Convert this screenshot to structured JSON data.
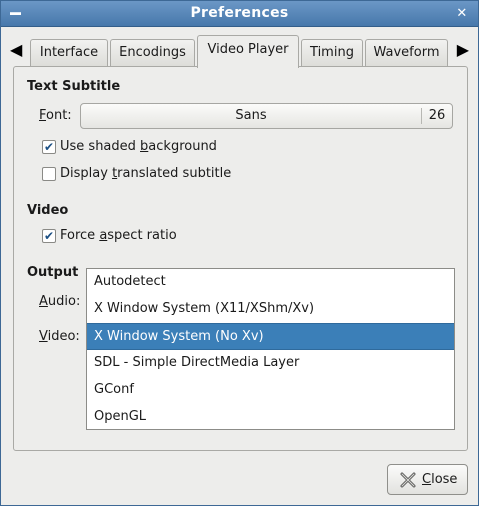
{
  "window": {
    "title": "Preferences"
  },
  "tabs": [
    {
      "label": "Interface"
    },
    {
      "label": "Encodings"
    },
    {
      "label": "Video Player"
    },
    {
      "label": "Timing"
    },
    {
      "label": "Waveform"
    }
  ],
  "active_tab": "Video Player",
  "text_subtitle": {
    "title": "Text Subtitle",
    "font_label_mn": "F",
    "font_label_rest": "ont:",
    "font_name": "Sans",
    "font_size": "26",
    "shaded_bg": {
      "pre": "Use shaded ",
      "mn": "b",
      "post": "ackground",
      "checked": true
    },
    "translated": {
      "pre": "Display ",
      "mn": "t",
      "post": "ranslated subtitle",
      "checked": false
    }
  },
  "video": {
    "title": "Video",
    "force_aspect": {
      "pre": "Force ",
      "mn": "a",
      "post": "spect ratio",
      "checked": true
    }
  },
  "output": {
    "title": "Output",
    "audio_mn": "A",
    "audio_rest": "udio:",
    "video_mn": "V",
    "video_rest": "ideo:",
    "options": [
      {
        "label": "Autodetect"
      },
      {
        "label": "X Window System (X11/XShm/Xv)"
      },
      {
        "label": "X Window System (No Xv)"
      },
      {
        "label": "SDL - Simple DirectMedia Layer"
      },
      {
        "label": "GConf"
      },
      {
        "label": "OpenGL"
      }
    ],
    "selected": "X Window System (No Xv)"
  },
  "buttons": {
    "close_mn": "C",
    "close_rest": "lose"
  },
  "icons": {
    "window_menu": "window-menu-icon",
    "window_close": "close-icon",
    "tab_left": "arrow-left-icon",
    "tab_right": "arrow-right-icon",
    "close_button": "close-x-icon"
  },
  "colors": {
    "titlebar": "#4778ab",
    "selection": "#3b7fb8",
    "window_bg": "#ededeb"
  }
}
